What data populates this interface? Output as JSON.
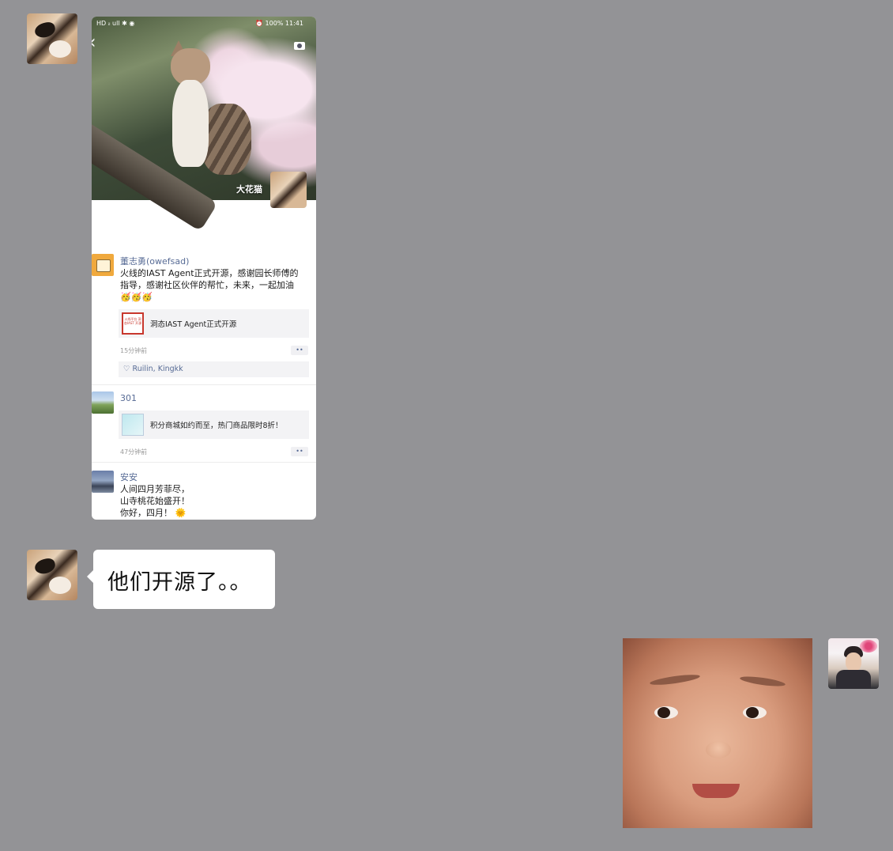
{
  "chat": {
    "shared_screenshot": {
      "status_bar": {
        "left": "HD ᵢₗ ull ✱ ◉",
        "right": "⏰ 100% 11:41"
      },
      "cover": {
        "name": "大花猫"
      },
      "posts": [
        {
          "author": "董志勇(owefsad)",
          "text": "火线的IAST Agent正式开源，感谢园长师傅的指导，感谢社区伙伴的帮忙，未来，一起加油🥳🥳🥳",
          "link": {
            "thumb_text": "火线平台 洞态IAST 开源",
            "title": "洞态IAST Agent正式开源"
          },
          "time": "15分钟前",
          "more": "••",
          "likes": "♡ Ruilin, Kingkk"
        },
        {
          "author": "301",
          "link": {
            "title": "积分商城如约而至，热门商品限时8折！"
          },
          "time": "47分钟前",
          "more": "••"
        },
        {
          "author": "安安",
          "text_lines": [
            "人间四月芳菲尽，",
            "山寺桃花始盛开！",
            "你好，四月！ 🌞"
          ]
        }
      ]
    },
    "message": {
      "text": "他们开源了。。"
    }
  }
}
